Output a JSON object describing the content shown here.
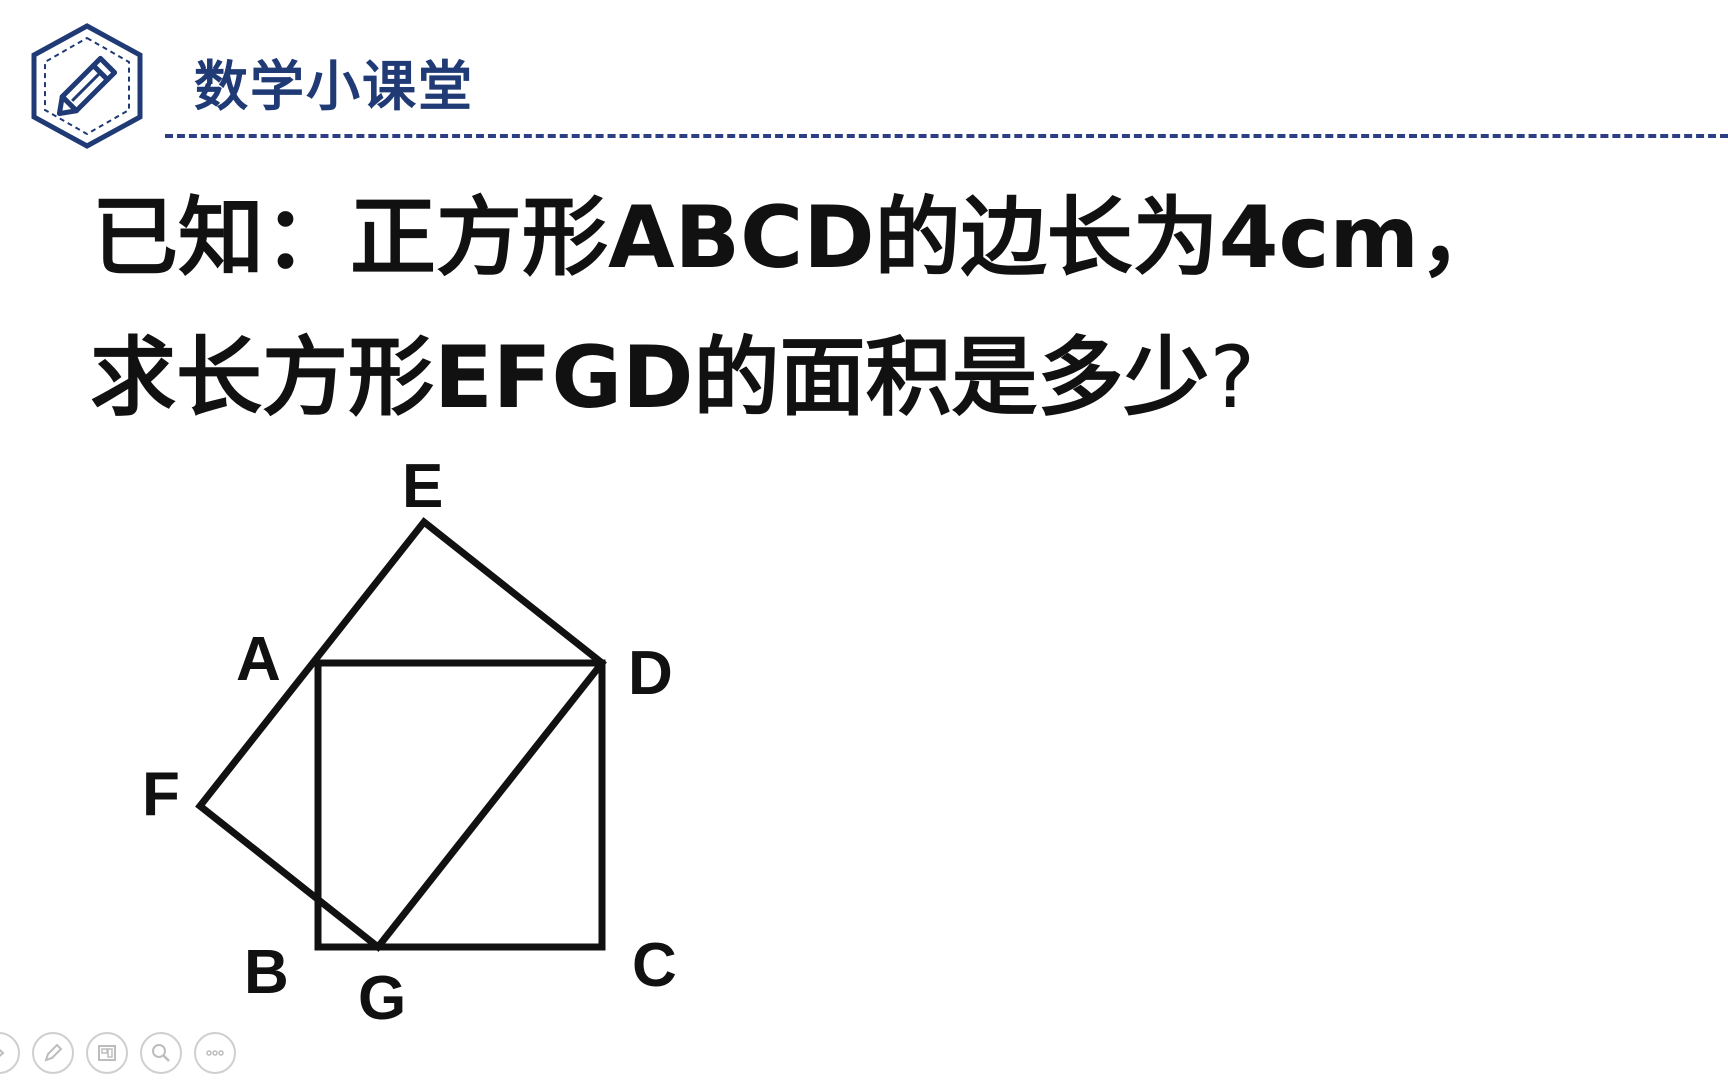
{
  "header": {
    "brand_title": "数学小课堂",
    "logo_icon": "pencil-icon",
    "accent_color": "#1f3a74"
  },
  "question": {
    "line1": "已知：正方形ABCD的边长为4cm，",
    "line2_text": "求长方形EFGD的面积是多少",
    "line2_mark": "?"
  },
  "figure": {
    "labels": {
      "E": "E",
      "A": "A",
      "D": "D",
      "F": "F",
      "B": "B",
      "G": "G",
      "C": "C"
    }
  },
  "toolbar": {
    "buttons": [
      {
        "name": "previous-button",
        "icon": "arrow-icon"
      },
      {
        "name": "pen-button",
        "icon": "pen-icon"
      },
      {
        "name": "slides-button",
        "icon": "slides-icon"
      },
      {
        "name": "zoom-button",
        "icon": "magnifier-icon"
      },
      {
        "name": "more-button",
        "icon": "ellipsis-icon"
      }
    ]
  }
}
